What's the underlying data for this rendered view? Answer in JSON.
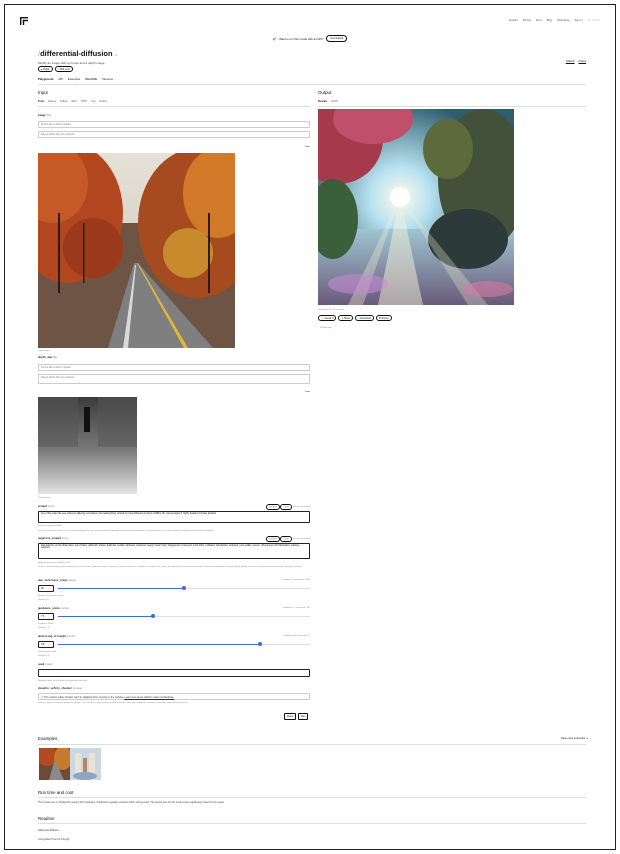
{
  "nav": {
    "items": [
      "Explore",
      "Pricing",
      "Docs",
      "Blog",
      "Changelog",
      "Sign in"
    ],
    "signup": "Try for free"
  },
  "banner": {
    "text": "Want to run this model with an API?",
    "button": "Get started"
  },
  "model": {
    "owner": "/",
    "name": "differential-diffusion",
    "lock": "⊘",
    "description": "Modify an image with a prompt and a depth image",
    "badges": [
      "● Public",
      "⏱ 60K runs"
    ],
    "links": [
      "GitHub",
      "Paper"
    ]
  },
  "tabs": [
    "Playground",
    "API",
    "Examples",
    "README",
    "Versions"
  ],
  "input": {
    "heading": "Input",
    "subtabs": [
      "Form",
      "Node.js",
      "Python",
      "Elixir",
      "HTTP",
      "Cog",
      "Docker"
    ],
    "image": {
      "label": "image",
      "type": "*file",
      "drop": "Drop a file or click to upload",
      "url_placeholder": "Take a photo with your webcam",
      "clear": "Clear",
      "help": "Input image"
    },
    "depth": {
      "label": "depth_map",
      "type": "*file",
      "drop": "Drop a file or click to upload",
      "url_placeholder": "Take a photo with your webcam",
      "clear": "Clear",
      "help": "Change map"
    },
    "prompt": {
      "label": "prompt",
      "type": "string",
      "buttons": [
        "Default",
        "Clear"
      ],
      "note": "⌘ Enter to submit",
      "value": "tree of life under the sea, ethereal, glittering, lens flares, cinematic lighting, artwork by Anna Dittmann & Carne Griffiths, 8k, unreal engine 5, highly detailed, intricate detailed",
      "help": "Prompt to guide the edit",
      "default": "Default: \"tree of life under the sea, ethereal, glittering, lens flares, cinematic lighting, artwork by Anna Dittmann & Carne Griffiths, 8k, unreal engine 5, highly detailed, intricate detailed\""
    },
    "negative": {
      "label": "negative_prompt",
      "type": "string",
      "buttons": [
        "Default",
        "Clear"
      ],
      "note": "⌘ Enter to submit",
      "value": "bad anatomy, poorly drawn face, out of frame, gibberish, lowres, duplicate, morbid, darkness, maniacal, creepy, fused, blurry background, crosseyed, extra limbs, mutilated, dehydrated, surprised, poor quality, uneven, off-centered, bird illustration, painting, cartoons",
      "help": "Negative prompt to guide the edit",
      "default": "Default: \"bad anatomy, poorly drawn face, out of frame, gibberish, lowres, duplicate, morbid, darkness, maniacal, creepy, fused, blurry background, crosseyed, extra limbs, mutilated, dehydrated, surprised, poor quality, uneven, off-centered, bird illustration, painting, cartoons\""
    },
    "steps": {
      "label": "num_inference_steps",
      "type": "integer",
      "range": "(minimum: 1, maximum: 100)",
      "value": "50",
      "fraction": 0.5,
      "help": "Number of inference steps",
      "default": "Default: 50"
    },
    "guidance": {
      "label": "guidance_scale",
      "type": "number",
      "range": "(minimum: 0, maximum: 20)",
      "value": "7.5",
      "fraction": 0.375,
      "help": "Guidance Scale",
      "default": "Default: 7.5"
    },
    "denoise": {
      "label": "denoising_strength",
      "type": "number",
      "range": "(minimum: 0, maximum: 1)",
      "value": "0.8",
      "fraction": 0.8,
      "help": "Denoising strength",
      "default": "Default: 0.8"
    },
    "seed": {
      "label": "seed",
      "type": "integer",
      "value": "",
      "help": "Random seed. Leave blank to randomize the seed"
    },
    "safety": {
      "label": "disable_safety_checker",
      "type": "boolean",
      "text": "This model's safety checker can't be disabled when running on the website.",
      "link": "Learn more about platform safety on Replicate.",
      "help": "Disable safety checker for generated images. This feature is only available through the API. See https://replicate.com/docs/how-does-replicate-work#safety"
    },
    "reset": "Reset",
    "run": "Run"
  },
  "output": {
    "heading": "Output",
    "subtabs": [
      "Preview",
      "JSON"
    ],
    "generated": "Generated in 7.93 seconds",
    "buttons": [
      "⚡ Tweak it",
      "⇪ Share",
      "⤓ Download",
      "⚑ Report"
    ],
    "logs": "▸ Show logs"
  },
  "examples": {
    "heading": "Examples",
    "view_more": "View more examples"
  },
  "runtime": {
    "heading": "Run time and cost",
    "text": "This model runs on Nvidia A40 (Large) GPU hardware. Predictions typically complete within 123 seconds. The predict time for this model varies significantly based on the inputs."
  },
  "readme": {
    "heading": "Readme",
    "lines": [
      "Differential Diffusion",
      "Giving Each Pixel Its Strength"
    ]
  }
}
